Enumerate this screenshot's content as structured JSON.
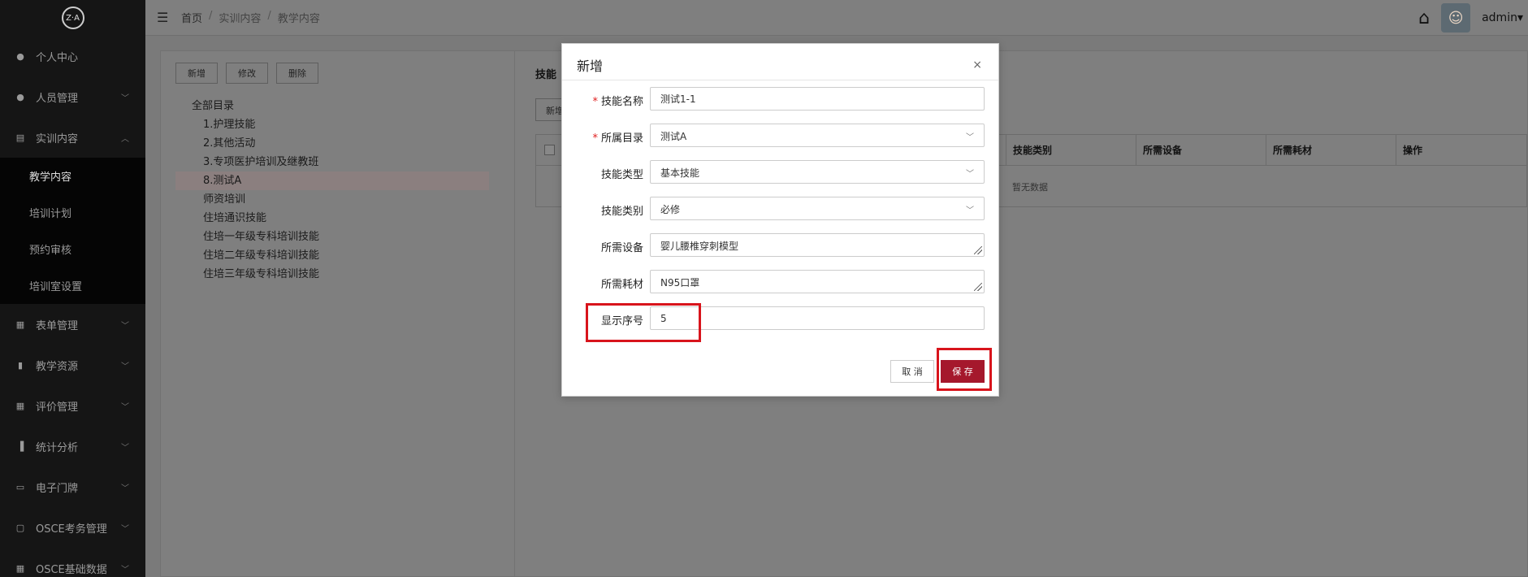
{
  "sidebar": {
    "logo": "Z·A",
    "items": [
      {
        "label": "个人中心",
        "icon": "user-icon",
        "glyph": "●",
        "has_children": false
      },
      {
        "label": "人员管理",
        "icon": "users-icon",
        "glyph": "●",
        "has_children": true
      },
      {
        "label": "实训内容",
        "icon": "training-icon",
        "glyph": "▤",
        "has_children": true,
        "expanded": true
      }
    ],
    "submenu": [
      {
        "label": "教学内容",
        "active": true
      },
      {
        "label": "培训计划",
        "active": false
      },
      {
        "label": "预约审核",
        "active": false
      },
      {
        "label": "培训室设置",
        "active": false
      }
    ],
    "items_after": [
      {
        "label": "表单管理",
        "icon": "form-icon",
        "glyph": "▦"
      },
      {
        "label": "教学资源",
        "icon": "resource-icon",
        "glyph": "▮"
      },
      {
        "label": "评价管理",
        "icon": "evaluation-icon",
        "glyph": "▦"
      },
      {
        "label": "统计分析",
        "icon": "bar-chart-icon",
        "glyph": "▐"
      },
      {
        "label": "电子门牌",
        "icon": "monitor-icon",
        "glyph": "▭"
      },
      {
        "label": "OSCE考务管理",
        "icon": "document-icon",
        "glyph": "▢"
      },
      {
        "label": "OSCE基础数据",
        "icon": "grid-icon",
        "glyph": "▦"
      }
    ]
  },
  "topbar": {
    "breadcrumb": [
      "首页",
      "实训内容",
      "教学内容"
    ],
    "username": "admin"
  },
  "left_panel": {
    "buttons": {
      "add": "新增",
      "edit": "修改",
      "delete": "删除"
    },
    "tree_root": "全部目录",
    "tree_nodes": [
      {
        "label": "1.护理技能",
        "selected": false
      },
      {
        "label": "2.其他活动",
        "selected": false
      },
      {
        "label": "3.专项医护培训及继教班",
        "selected": false
      },
      {
        "label": "8.测试A",
        "selected": true
      },
      {
        "label": "师资培训",
        "selected": false
      },
      {
        "label": "住培通识技能",
        "selected": false
      },
      {
        "label": "住培一年级专科培训技能",
        "selected": false
      },
      {
        "label": "住培二年级专科培训技能",
        "selected": false
      },
      {
        "label": "住培三年级专科培训技能",
        "selected": false
      }
    ]
  },
  "right_panel": {
    "title": "技能",
    "add_button": "新增",
    "columns": [
      "技能类别",
      "所需设备",
      "所需耗材",
      "操作"
    ],
    "empty_text": "暂无数据"
  },
  "modal": {
    "title": "新增",
    "fields": {
      "skill_name": {
        "label": "技能名称",
        "required": true,
        "value": "测试1-1"
      },
      "directory": {
        "label": "所属目录",
        "required": true,
        "value": "测试A"
      },
      "skill_type": {
        "label": "技能类型",
        "required": false,
        "value": "基本技能"
      },
      "skill_category": {
        "label": "技能类别",
        "required": false,
        "value": "必修"
      },
      "equipment": {
        "label": "所需设备",
        "required": false,
        "value": "婴儿腰椎穿刺模型"
      },
      "consumables": {
        "label": "所需耗材",
        "required": false,
        "value": "N95口罩"
      },
      "display_order": {
        "label": "显示序号",
        "required": false,
        "value": "5"
      }
    },
    "cancel_label": "取 消",
    "save_label": "保 存",
    "required_mark": "*",
    "close_glyph": "×"
  },
  "highlight_color": "#d8141c",
  "accent_color": "#a5182c"
}
